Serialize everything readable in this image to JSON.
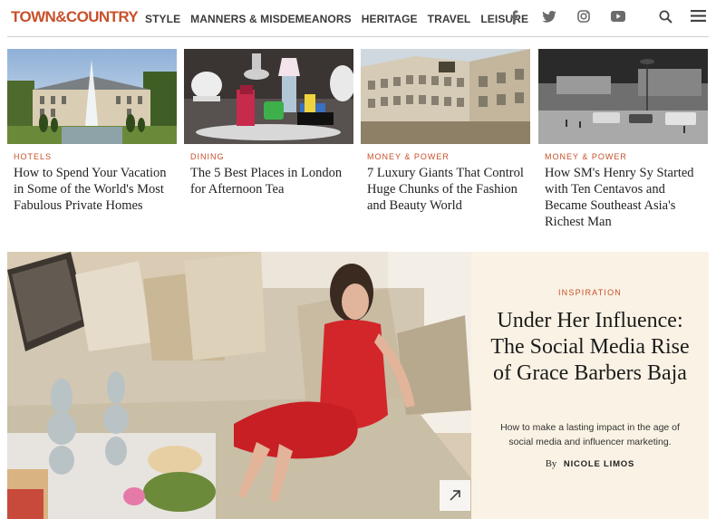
{
  "header": {
    "logo": "TOWN&COUNTRY",
    "nav": [
      "STYLE",
      "MANNERS & MISDEMEANORS",
      "HERITAGE",
      "TRAVEL",
      "LEISURE"
    ],
    "social_icons": [
      "facebook-icon",
      "twitter-icon",
      "instagram-icon",
      "youtube-icon"
    ],
    "utility_icons": [
      "search-icon",
      "menu-icon"
    ]
  },
  "cards": [
    {
      "category": "HOTELS",
      "title": "How to Spend Your Vacation in Some of the World's Most Fabulous Private Homes"
    },
    {
      "category": "DINING",
      "title": "The 5 Best Places in London for Afternoon Tea"
    },
    {
      "category": "MONEY & POWER",
      "title": "7 Luxury Giants That Control Huge Chunks of the Fashion and Beauty World"
    },
    {
      "category": "MONEY & POWER",
      "title": "How SM's Henry Sy Started with Ten Centavos and Became Southeast Asia's Richest Man"
    }
  ],
  "hero": {
    "category": "INSPIRATION",
    "title": "Under Her Influence: The Social Media Rise of Grace Barbers Baja",
    "dek": "How to make a lasting impact in the age of social media and influencer marketing.",
    "by": "By",
    "author": "NICOLE LIMOS"
  },
  "colors": {
    "accent": "#c8502a",
    "hero_panel": "#faf2e4",
    "nav_text": "#3b3b3b"
  }
}
